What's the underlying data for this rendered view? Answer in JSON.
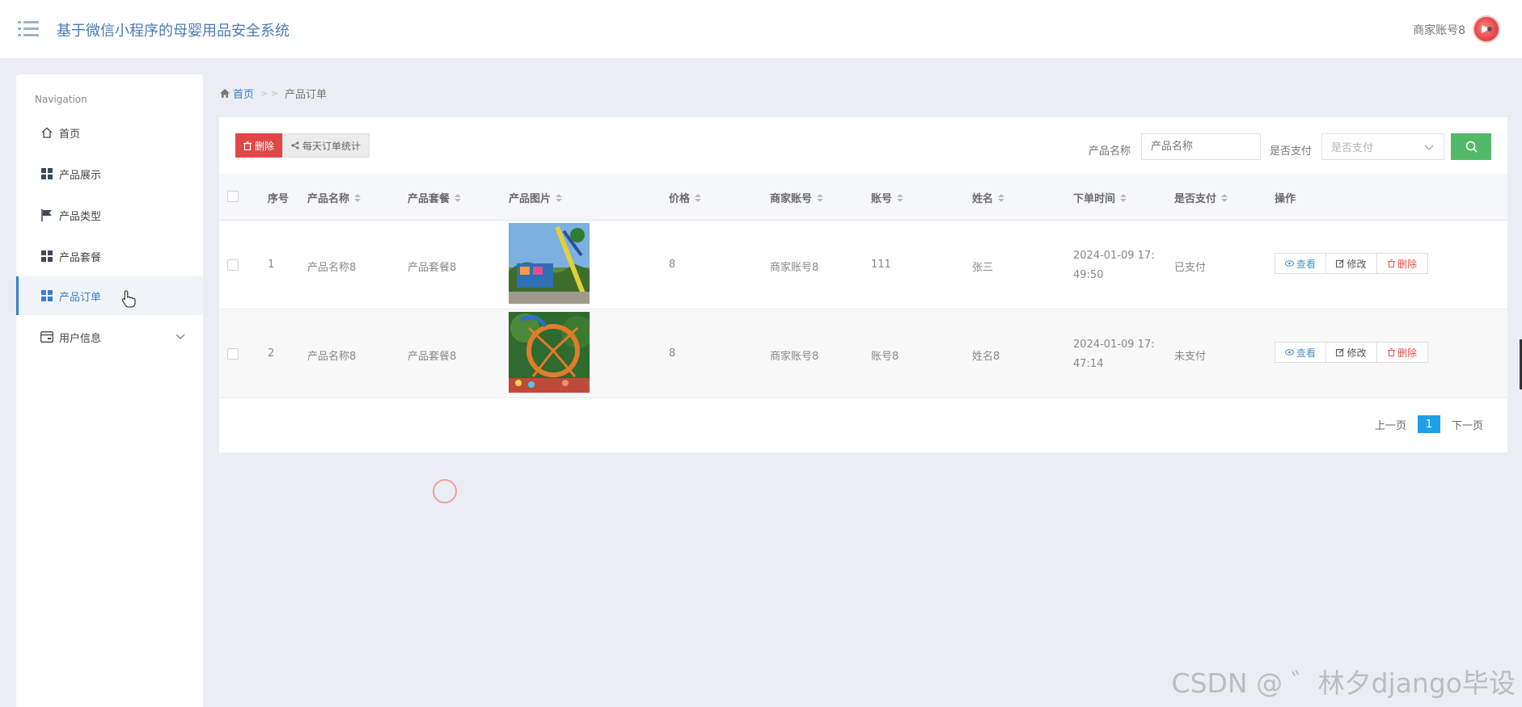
{
  "header": {
    "app_title": "基于微信小程序的母婴用品安全系统",
    "user_name": "商家账号8"
  },
  "sidebar": {
    "heading": "Navigation",
    "items": [
      {
        "label": "首页",
        "icon": "home-icon"
      },
      {
        "label": "产品展示",
        "icon": "grid-icon"
      },
      {
        "label": "产品类型",
        "icon": "flag-icon"
      },
      {
        "label": "产品套餐",
        "icon": "grid-icon"
      },
      {
        "label": "产品订单",
        "icon": "grid-icon",
        "active": true
      },
      {
        "label": "用户信息",
        "icon": "card-icon",
        "expandable": true
      }
    ]
  },
  "breadcrumb": {
    "home": "首页",
    "separator": "> >",
    "current": "产品订单"
  },
  "toolbar": {
    "delete_label": "删除",
    "stats_label": "每天订单统计",
    "product_name_label": "产品名称",
    "product_name_placeholder": "产品名称",
    "paid_label": "是否支付",
    "paid_placeholder": "是否支付"
  },
  "table": {
    "columns": [
      "序号",
      "产品名称",
      "产品套餐",
      "产品图片",
      "价格",
      "商家账号",
      "账号",
      "姓名",
      "下单时间",
      "是否支付",
      "操作"
    ],
    "rows": [
      {
        "index": "1",
        "product_name": "产品名称8",
        "package": "产品套餐8",
        "price": "8",
        "merchant": "商家账号8",
        "account": "111",
        "name": "张三",
        "time_line1": "2024-01-09 17:",
        "time_line2": "49:50",
        "paid": "已支付"
      },
      {
        "index": "2",
        "product_name": "产品名称8",
        "package": "产品套餐8",
        "price": "8",
        "merchant": "商家账号8",
        "account": "账号8",
        "name": "姓名8",
        "time_line1": "2024-01-09 17:",
        "time_line2": "47:14",
        "paid": "未支付"
      }
    ],
    "actions": {
      "view": "查看",
      "edit": "修改",
      "delete": "删除"
    }
  },
  "pagination": {
    "prev": "上一页",
    "current": "1",
    "next": "下一页"
  },
  "watermark": "CSDN @ ゛林夕django毕设",
  "colors": {
    "accent": "#3b7fd0",
    "danger": "#e04848",
    "success": "#52b96a",
    "page_active": "#1ea0e6"
  }
}
